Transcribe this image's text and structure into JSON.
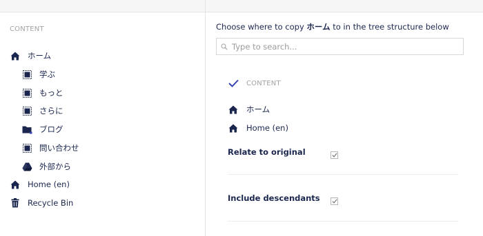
{
  "tree": {
    "header": "CONTENT",
    "items": [
      {
        "label": "ホーム",
        "icon": "home-icon"
      },
      {
        "label": "学ぶ",
        "icon": "document-icon"
      },
      {
        "label": "もっと",
        "icon": "document-icon"
      },
      {
        "label": "さらに",
        "icon": "document-icon"
      },
      {
        "label": "ブログ",
        "icon": "folder-icon"
      },
      {
        "label": "問い合わせ",
        "icon": "document-icon"
      },
      {
        "label": "外部から",
        "icon": "drive-icon"
      },
      {
        "label": "Home (en)",
        "icon": "home-icon"
      },
      {
        "label": "Recycle Bin",
        "icon": "trash-icon"
      }
    ]
  },
  "panel": {
    "instruction_pre": "Choose where to copy ",
    "instruction_item": "ホーム",
    "instruction_post": " to in the tree structure below",
    "search_placeholder": "Type to search...",
    "targets": [
      {
        "label": "CONTENT",
        "icon": "checkmark-icon"
      },
      {
        "label": "ホーム",
        "icon": "home-icon"
      },
      {
        "label": "Home (en)",
        "icon": "home-icon"
      }
    ],
    "options": [
      {
        "label": "Relate to original",
        "checked": true
      },
      {
        "label": "Include descendants",
        "checked": true
      }
    ]
  },
  "colors": {
    "text": "#1b264f",
    "muted": "#a3a3a3",
    "check_accent": "#3544b1",
    "border": "#e3e3e3"
  }
}
